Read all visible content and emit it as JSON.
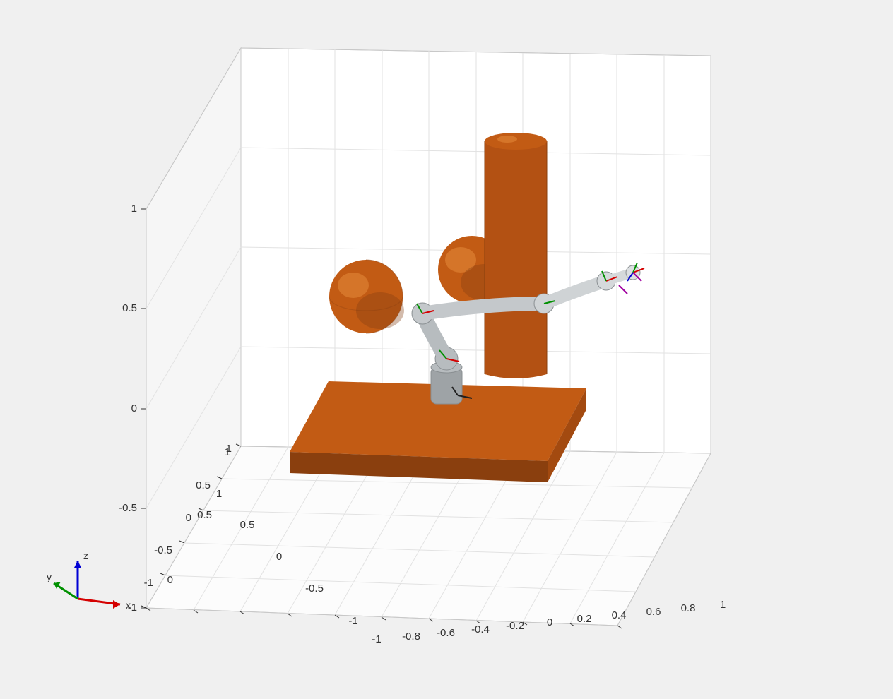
{
  "chart_data": {
    "type": "scatter",
    "title": "",
    "xlabel": "",
    "ylabel": "",
    "zlabel": "",
    "xlim": [
      -1,
      1
    ],
    "ylim": [
      -1,
      1
    ],
    "zlim": [
      -1,
      1
    ],
    "x_ticks": [
      "-1",
      "-0.8",
      "-0.6",
      "-0.4",
      "-0.2",
      "0",
      "0.2",
      "0.4",
      "0.6",
      "0.8",
      "1"
    ],
    "y_ticks": [
      "-1",
      "-0.5",
      "0",
      "0.5",
      "1"
    ],
    "z_ticks": [
      "-1",
      "-0.5",
      "0",
      "0.5",
      "1"
    ],
    "scene_objects": [
      {
        "name": "floor_box",
        "type": "box",
        "center": [
          0,
          0,
          -0.25
        ],
        "size": [
          0.8,
          0.8,
          0.07
        ],
        "color": "#c25b14"
      },
      {
        "name": "cylinder",
        "type": "cylinder",
        "center": [
          0.2,
          0.2,
          0.45
        ],
        "radius": 0.1,
        "height": 0.9,
        "color": "#c25b14"
      },
      {
        "name": "sphere_left",
        "type": "sphere",
        "center": [
          -0.35,
          0.0,
          0.15
        ],
        "radius": 0.13,
        "color": "#c25b14"
      },
      {
        "name": "sphere_right",
        "type": "sphere",
        "center": [
          0.1,
          0.25,
          0.2
        ],
        "radius": 0.13,
        "color": "#c25b14"
      },
      {
        "name": "robot_arm",
        "type": "robot",
        "base": [
          0,
          0,
          -0.2
        ],
        "end_effector": [
          0.7,
          0.1,
          0.1
        ],
        "color": "#bfc3c5"
      }
    ],
    "axis_indicator": {
      "x_label": "x",
      "y_label": "y",
      "z_label": "z",
      "x_color": "#d40000",
      "y_color": "#009000",
      "z_color": "#0000d4"
    }
  }
}
